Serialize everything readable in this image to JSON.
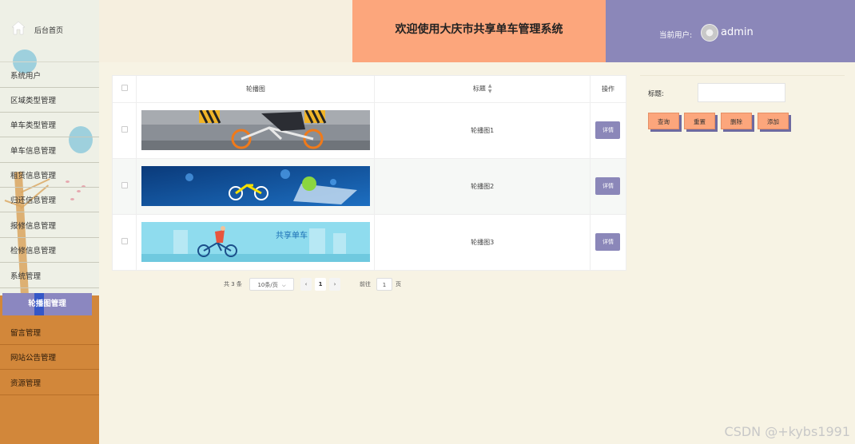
{
  "sidebar": {
    "home_label": "后台首页",
    "items": [
      "系统用户",
      "区域类型管理",
      "单车类型管理",
      "单车信息管理",
      "租赁信息管理",
      "归还信息管理",
      "报修信息管理",
      "检修信息管理",
      "系统管理"
    ],
    "active": "轮播图管理",
    "lower_items": [
      "留言管理",
      "网站公告管理",
      "资源管理"
    ]
  },
  "header": {
    "title": "欢迎使用大庆市共享单车管理系统",
    "user_label": "当前用户:",
    "username": "admin"
  },
  "table": {
    "columns": [
      "轮播图",
      "标题",
      "操作"
    ],
    "rows": [
      {
        "title": "轮播图1",
        "action": "详情"
      },
      {
        "title": "轮播图2",
        "action": "详情"
      },
      {
        "title": "轮播图3",
        "action": "详情"
      }
    ]
  },
  "pagination": {
    "total": "共 3 条",
    "page_size": "10条/页",
    "current": "1",
    "goto_label": "前往",
    "goto_value": "1",
    "page_suffix": "页"
  },
  "search": {
    "label": "标题:",
    "value": "",
    "buttons": {
      "query": "查询",
      "reset": "重置",
      "delete": "删除",
      "add": "添加"
    }
  },
  "banner3_text": "共享单车",
  "watermark": "CSDN @+kybs1991",
  "colors": {
    "accent_purple": "#8b87b9",
    "accent_orange": "#fca67c",
    "sidebar_orange": "#d2873a"
  }
}
